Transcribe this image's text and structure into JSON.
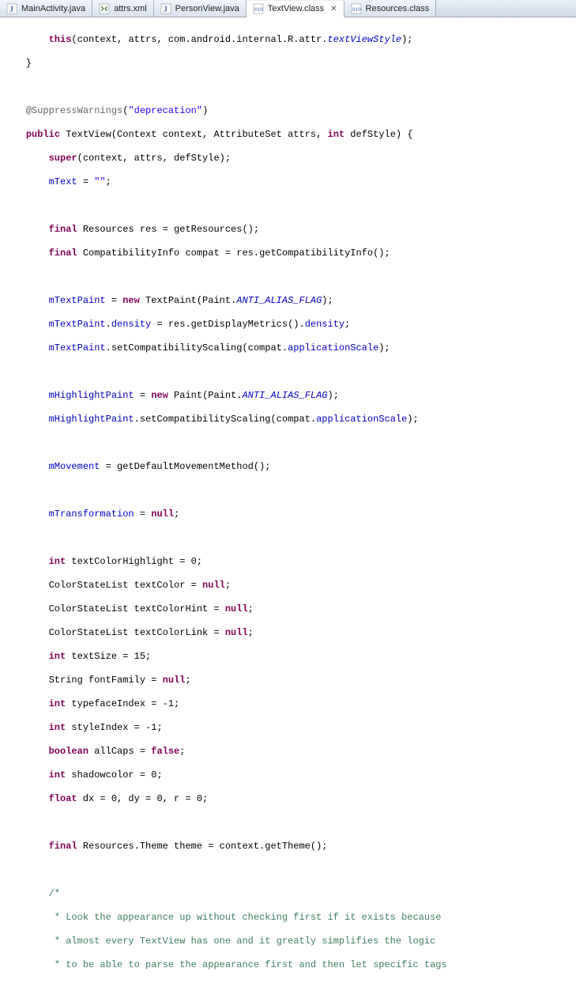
{
  "tabs": [
    {
      "label": "MainActivity.java",
      "icon": "java",
      "active": false
    },
    {
      "label": "attrs.xml",
      "icon": "xml",
      "active": false
    },
    {
      "label": "PersonView.java",
      "icon": "java",
      "active": false
    },
    {
      "label": "TextView.class",
      "icon": "class",
      "active": true
    },
    {
      "label": "Resources.class",
      "icon": "class",
      "active": false
    }
  ],
  "code": {
    "l0_a": "        ",
    "l0_kw": "this",
    "l0_b": "(context, attrs, com.android.internal.R.attr.",
    "l0_f": "textViewStyle",
    "l0_c": ");",
    "l1": "    }",
    "l3_a": "    ",
    "l3_ann": "@SuppressWarnings",
    "l3_b": "(",
    "l3_str": "\"deprecation\"",
    "l3_c": ")",
    "l4_a": "    ",
    "l4_kw1": "public",
    "l4_b": " TextView(Context context, AttributeSet attrs, ",
    "l4_kw2": "int",
    "l4_c": " defStyle) {",
    "l5_a": "        ",
    "l5_kw": "super",
    "l5_b": "(context, attrs, defStyle);",
    "l6_a": "        ",
    "l6_f": "mText",
    "l6_b": " = ",
    "l6_s": "\"\"",
    "l6_c": ";",
    "l8_a": "        ",
    "l8_kw": "final",
    "l8_b": " Resources res = getResources();",
    "l9_a": "        ",
    "l9_kw": "final",
    "l9_b": " CompatibilityInfo compat = res.getCompatibilityInfo();",
    "l11_a": "        ",
    "l11_f": "mTextPaint",
    "l11_b": " = ",
    "l11_kw": "new",
    "l11_c": " TextPaint(Paint.",
    "l11_s": "ANTI_ALIAS_FLAG",
    "l11_d": ");",
    "l12_a": "        ",
    "l12_f1": "mTextPaint",
    "l12_b": ".",
    "l12_f2": "density",
    "l12_c": " = res.getDisplayMetrics().",
    "l12_f3": "density",
    "l12_d": ";",
    "l13_a": "        ",
    "l13_f": "mTextPaint",
    "l13_b": ".setCompatibilityScaling(compat.",
    "l13_f2": "applicationScale",
    "l13_c": ");",
    "l15_a": "        ",
    "l15_f": "mHighlightPaint",
    "l15_b": " = ",
    "l15_kw": "new",
    "l15_c": " Paint(Paint.",
    "l15_s": "ANTI_ALIAS_FLAG",
    "l15_d": ");",
    "l16_a": "        ",
    "l16_f": "mHighlightPaint",
    "l16_b": ".setCompatibilityScaling(compat.",
    "l16_f2": "applicationScale",
    "l16_c": ");",
    "l18_a": "        ",
    "l18_f": "mMovement",
    "l18_b": " = getDefaultMovementMethod();",
    "l20_a": "        ",
    "l20_f": "mTransformation",
    "l20_b": " = ",
    "l20_kw": "null",
    "l20_c": ";",
    "l22_a": "        ",
    "l22_kw": "int",
    "l22_b": " textColorHighlight = 0;",
    "l23_a": "        ColorStateList textColor = ",
    "l23_kw": "null",
    "l23_b": ";",
    "l24_a": "        ColorStateList textColorHint = ",
    "l24_kw": "null",
    "l24_b": ";",
    "l25_a": "        ColorStateList textColorLink = ",
    "l25_kw": "null",
    "l25_b": ";",
    "l26_a": "        ",
    "l26_kw": "int",
    "l26_b": " textSize = 15;",
    "l27_a": "        String fontFamily = ",
    "l27_kw": "null",
    "l27_b": ";",
    "l28_a": "        ",
    "l28_kw": "int",
    "l28_b": " typefaceIndex = -1;",
    "l29_a": "        ",
    "l29_kw": "int",
    "l29_b": " styleIndex = -1;",
    "l30_a": "        ",
    "l30_kw": "boolean",
    "l30_b": " allCaps = ",
    "l30_kw2": "false",
    "l30_c": ";",
    "l31_a": "        ",
    "l31_kw": "int",
    "l31_b": " shadowcolor = 0;",
    "l32_a": "        ",
    "l32_kw": "float",
    "l32_b": " dx = 0, dy = 0, r = 0;",
    "l34_a": "        ",
    "l34_kw": "final",
    "l34_b": " Resources.Theme theme = context.getTheme();",
    "c1": "        /*",
    "c2": "         * Look the appearance up without checking first if it exists because",
    "c3": "         * almost every TextView has one and it greatly simplifies the logic",
    "c4": "         * to be able to parse the appearance first and then let specific tags"
  }
}
